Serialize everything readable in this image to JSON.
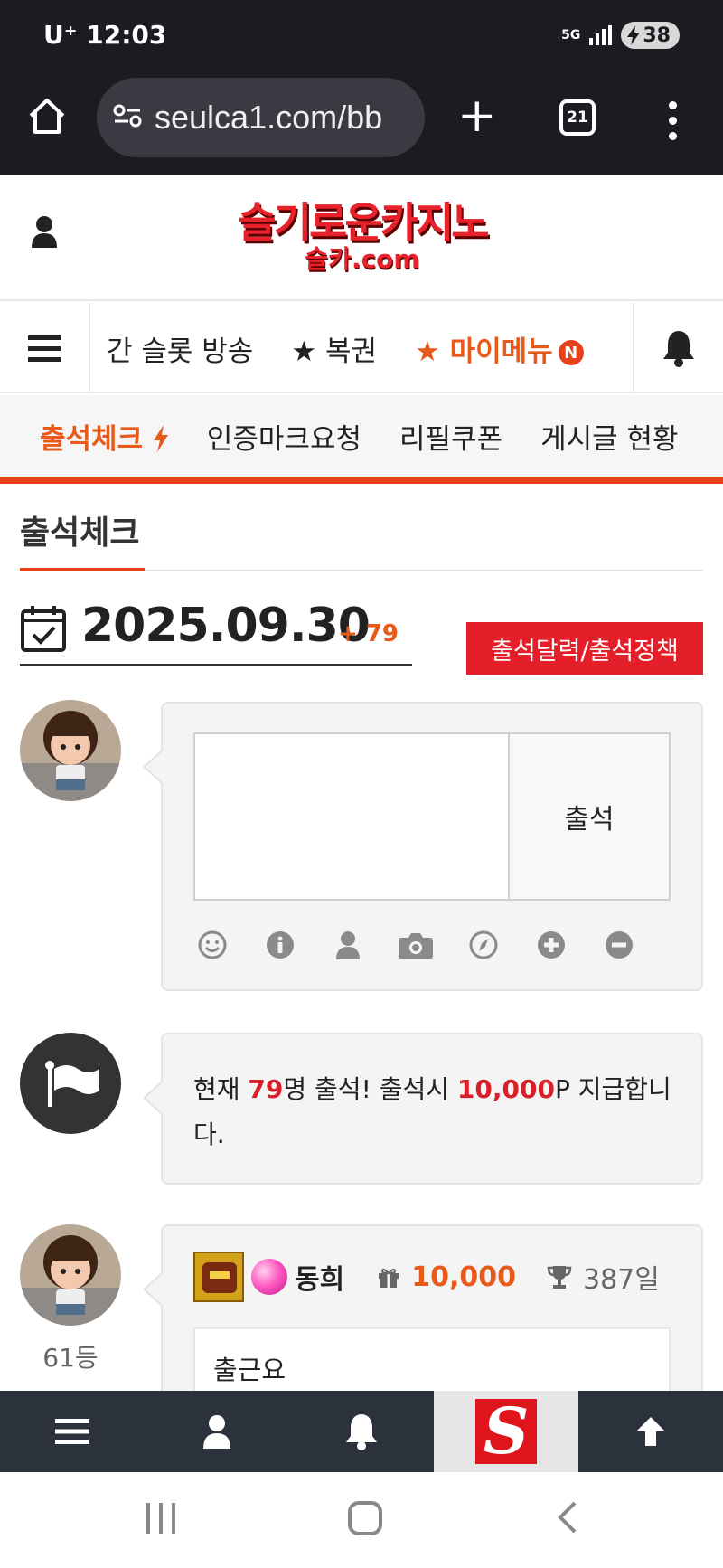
{
  "status_bar": {
    "carrier": "U⁺",
    "time": "12:03",
    "network": "5G",
    "battery": "38"
  },
  "browser": {
    "url": "seulca1.com/bb",
    "tab_count": "21"
  },
  "site": {
    "logo_main": "슬기로운카지노",
    "logo_sub": "슬카.com"
  },
  "nav": {
    "items": [
      {
        "label": "간 슬롯 방송"
      },
      {
        "label": "★ 복권"
      },
      {
        "label": "★ 마이메뉴"
      }
    ],
    "new_badge": "N"
  },
  "submenu": {
    "items": [
      {
        "label": "출석체크"
      },
      {
        "label": "인증마크요청"
      },
      {
        "label": "리필쿠폰"
      },
      {
        "label": "게시글 현황"
      }
    ]
  },
  "page": {
    "title": "출석체크",
    "date": "2025.09.30",
    "count_delta": "+ 79",
    "policy_button": "출석달력/출석정책"
  },
  "composer": {
    "submit_label": "출석",
    "tools": [
      "smile-icon",
      "info-icon",
      "user-icon",
      "camera-icon",
      "compass-icon",
      "plus-circle-icon",
      "minus-circle-icon"
    ]
  },
  "notice": {
    "prefix": "현재 ",
    "count": "79",
    "middle": "명 출석! 출석시 ",
    "points": "10,000",
    "suffix": "P 지급합니다."
  },
  "entry": {
    "rank": "61등",
    "name": "동희",
    "points": "10,000",
    "days": "387일",
    "message": "출근요"
  },
  "colors": {
    "accent": "#e85a1a",
    "red_button": "#e51f2a",
    "dark_bar": "#1b1c22",
    "bottom_bar": "#2c323c"
  }
}
